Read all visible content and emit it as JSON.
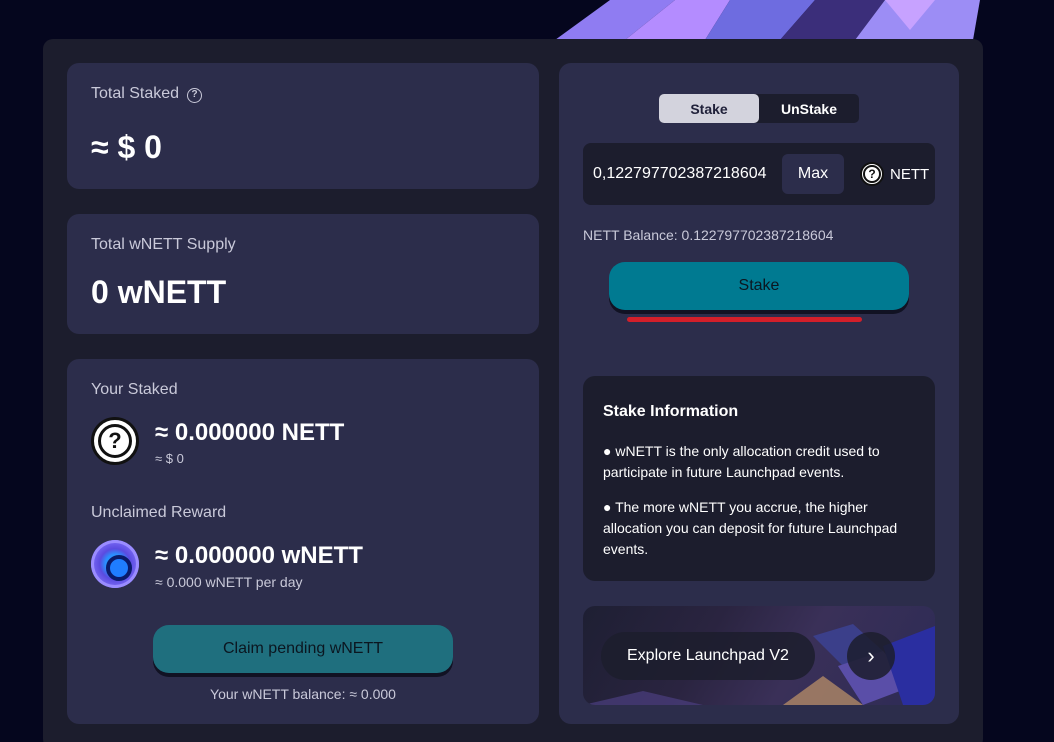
{
  "total_staked": {
    "label": "Total Staked",
    "value": "≈ $ 0"
  },
  "total_supply": {
    "label": "Total wNETT Supply",
    "value": "0 wNETT"
  },
  "your_staked": {
    "label": "Your Staked",
    "amount": "≈ 0.000000 NETT",
    "usd": "≈ $ 0"
  },
  "unclaimed": {
    "label": "Unclaimed Reward",
    "amount": "≈ 0.000000 wNETT",
    "rate": "≈ 0.000 wNETT per day"
  },
  "claim": {
    "button_label": "Claim pending wNETT",
    "balance_text": "Your wNETT balance: ≈ 0.000"
  },
  "toggle": {
    "stake_label": "Stake",
    "unstake_label": "UnStake",
    "active": "Stake"
  },
  "input": {
    "value": "0,122797702387218604",
    "max_label": "Max",
    "token": "NETT"
  },
  "balance_line": "NETT Balance: 0.122797702387218604",
  "stake_button_label": "Stake",
  "info": {
    "title": "Stake Information",
    "points": [
      "● wNETT is the only allocation credit used to participate in future Launchpad events.",
      "● The more wNETT you accrue, the higher allocation you can deposit for future Launchpad events."
    ]
  },
  "explore": {
    "label": "Explore Launchpad V2",
    "arrow": "›"
  },
  "icons": {
    "help": "question-circle-icon",
    "nett_token": "question-token-icon",
    "wnett_token": "wnett-token-icon",
    "arrow": "chevron-right-icon"
  },
  "colors": {
    "panel": "#1c1d2d",
    "card": "#2c2d4b",
    "stake_button": "#007a91",
    "claim_button": "#1f6f7e",
    "underline": "#d21f2a"
  }
}
